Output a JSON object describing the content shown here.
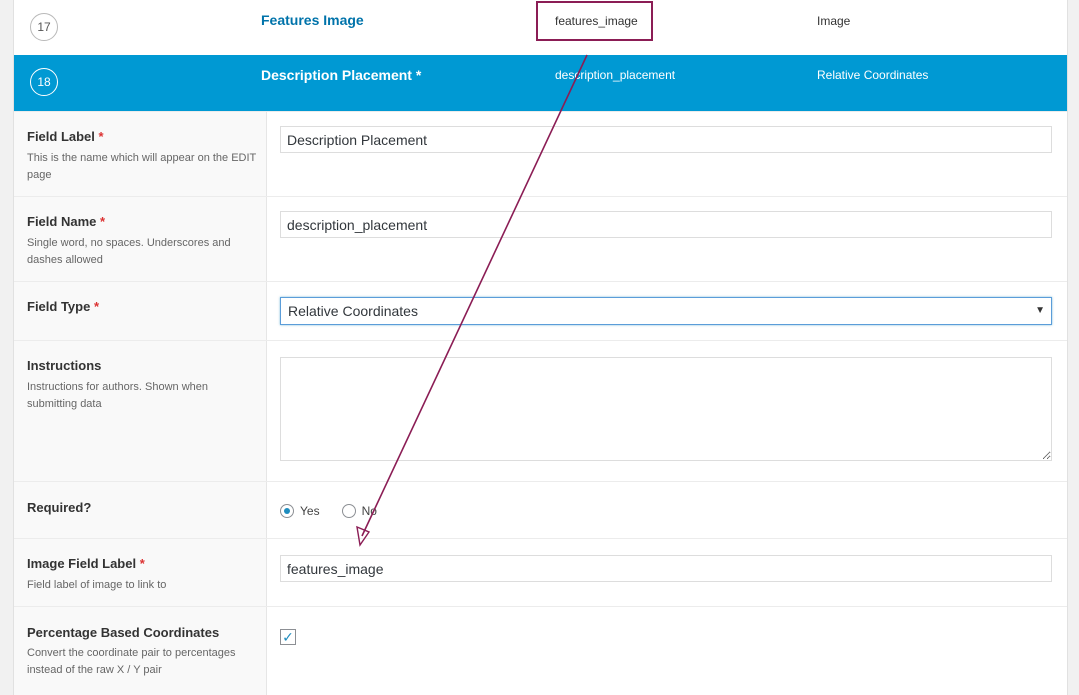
{
  "field_list": [
    {
      "order": "17",
      "label": "Features Image",
      "name": "features_image",
      "type": "Image"
    },
    {
      "order": "18",
      "label": "Description Placement *",
      "name": "description_placement",
      "type": "Relative Coordinates"
    }
  ],
  "settings": {
    "field_label": {
      "title": "Field Label",
      "required": "*",
      "desc": "This is the name which will appear on the EDIT page",
      "value": "Description Placement"
    },
    "field_name": {
      "title": "Field Name",
      "required": "*",
      "desc": "Single word, no spaces. Underscores and dashes allowed",
      "value": "description_placement"
    },
    "field_type": {
      "title": "Field Type",
      "required": "*",
      "selected": "Relative Coordinates",
      "arrow": "▼"
    },
    "instructions": {
      "title": "Instructions",
      "desc": "Instructions for authors. Shown when submitting data",
      "value": ""
    },
    "required": {
      "title": "Required?",
      "yes": "Yes",
      "no": "No"
    },
    "image_field_label": {
      "title": "Image Field Label",
      "required": "*",
      "desc": "Field label of image to link to",
      "value": "features_image"
    },
    "percentage": {
      "title": "Percentage Based Coordinates",
      "desc": "Convert the coordinate pair to percentages instead of the raw X / Y pair",
      "checkmark": "✓"
    }
  },
  "colors": {
    "active_row": "#0099d3",
    "annotation": "#8b1d55",
    "link": "#0073aa"
  }
}
